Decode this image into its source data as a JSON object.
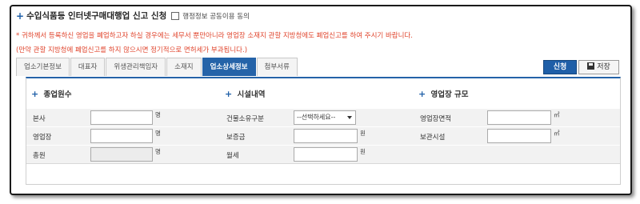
{
  "header": {
    "title": "수입식품등 인터넷구매대행업 신고 신청",
    "consent_label": "행정정보 공동이용 동의"
  },
  "notices": {
    "line1": "* 귀하께서 등록하신 영업을 폐업하고자 하실 경우에는 세무서 뿐만아니라 영업장 소재지 관할 지방청에도 폐업신고를 하여 주시기 바랍니다.",
    "line2": "(만약 관할 지방청에 폐업신고를 하지 않으시면 정기적으로 면허세가 부과됩니다.)"
  },
  "tabs": [
    {
      "label": "업소기본정보",
      "active": false
    },
    {
      "label": "대표자",
      "active": false
    },
    {
      "label": "위생관리책임자",
      "active": false
    },
    {
      "label": "소재지",
      "active": false
    },
    {
      "label": "업소상세정보",
      "active": true
    },
    {
      "label": "첨부서류",
      "active": false
    }
  ],
  "buttons": {
    "apply": "신청",
    "save": "저장"
  },
  "sections": {
    "staff": {
      "title": "종업원수",
      "rows": [
        {
          "label": "본사",
          "value": "",
          "unit": "명"
        },
        {
          "label": "영업장",
          "value": "",
          "unit": "명"
        },
        {
          "label": "총원",
          "value": "",
          "unit": "명"
        }
      ]
    },
    "facility": {
      "title": "시설내역",
      "rows": [
        {
          "label": "건물소유구분",
          "value": "--선택하세요--"
        },
        {
          "label": "보증금",
          "value": "",
          "unit": "원"
        },
        {
          "label": "월세",
          "value": "",
          "unit": "원"
        }
      ]
    },
    "scale": {
      "title": "영업장 규모",
      "rows": [
        {
          "label": "영업장면적",
          "value": "",
          "unit": "㎡"
        },
        {
          "label": "보관시설",
          "value": "",
          "unit": "㎡"
        }
      ]
    }
  },
  "colors": {
    "accent": "#2563a8",
    "notice": "#e0452d"
  }
}
